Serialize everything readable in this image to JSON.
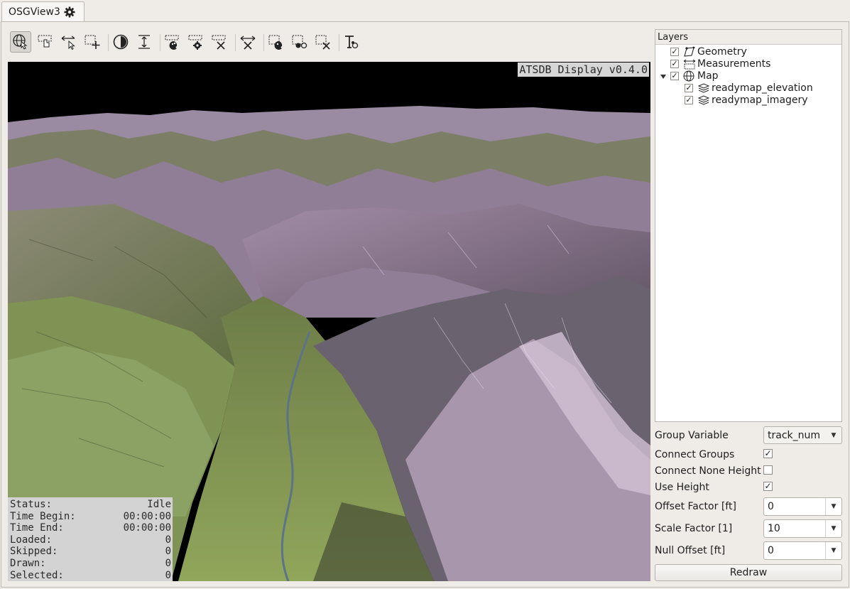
{
  "tab": {
    "title": "OSGView3"
  },
  "toolbar": {
    "icons": [
      "navigate-icon",
      "select-hand-icon",
      "measure-arrow-icon",
      "add-area-icon",
      "time-filter-icon",
      "height-icon",
      "style-icon",
      "style-settings-icon",
      "clear-style-icon",
      "remove-measure-icon",
      "select-group-icon",
      "select-points-icon",
      "clear-selection-icon",
      "text-label-icon"
    ]
  },
  "viewport": {
    "display_title": "ATSDB Display v0.4.0",
    "stats": [
      {
        "label": "Status:",
        "value": "Idle"
      },
      {
        "label": "Time Begin:",
        "value": "00:00:00"
      },
      {
        "label": "Time End:",
        "value": "00:00:00"
      },
      {
        "label": "Loaded:",
        "value": "0"
      },
      {
        "label": "Skipped:",
        "value": "0"
      },
      {
        "label": "Drawn:",
        "value": "0"
      },
      {
        "label": "Selected:",
        "value": "0"
      }
    ]
  },
  "layers": {
    "title": "Layers",
    "items": [
      {
        "label": "Geometry",
        "checked": true,
        "icon": "geometry-icon"
      },
      {
        "label": "Measurements",
        "checked": true,
        "icon": "measurements-icon"
      },
      {
        "label": "Map",
        "checked": true,
        "icon": "globe-icon",
        "expanded": true
      },
      {
        "label": "readymap_elevation",
        "checked": true,
        "icon": "layers-icon"
      },
      {
        "label": "readymap_imagery",
        "checked": true,
        "icon": "layers-icon"
      }
    ]
  },
  "settings": {
    "group_variable_label": "Group Variable",
    "group_variable_value": "track_num",
    "connect_groups_label": "Connect Groups",
    "connect_groups_checked": true,
    "connect_none_height_label": "Connect None Height",
    "connect_none_height_checked": false,
    "use_height_label": "Use Height",
    "use_height_checked": true,
    "offset_factor_label": "Offset Factor [ft]",
    "offset_factor_value": "0",
    "scale_factor_label": "Scale Factor [1]",
    "scale_factor_value": "10",
    "null_offset_label": "Null Offset [ft]",
    "null_offset_value": "0",
    "redraw_label": "Redraw"
  }
}
